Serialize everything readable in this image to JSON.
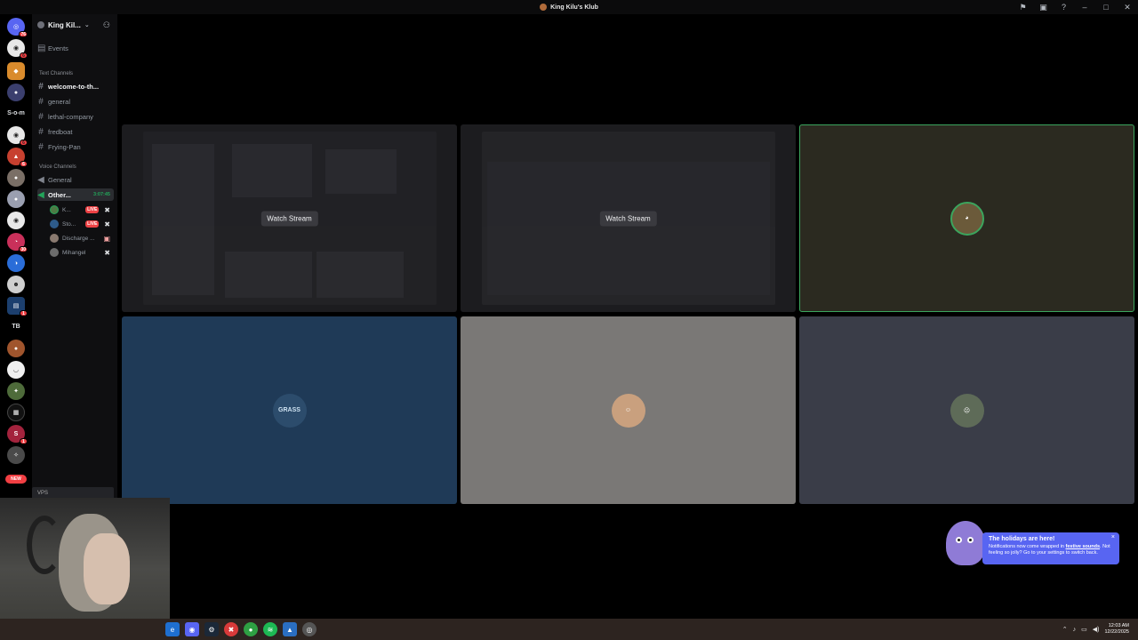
{
  "window": {
    "title": "King Kilu's Klub"
  },
  "titlebar_icons": [
    "flag-icon",
    "screen-icon",
    "help-icon"
  ],
  "server_rail": {
    "text_label": "S-o-m",
    "tb_label": "TB",
    "new_label": "NEW",
    "badges": [
      "76",
      "6",
      "6",
      "6",
      "30",
      "1",
      "1"
    ]
  },
  "sidebar": {
    "guild_name": "King Kil...",
    "events_label": "Events",
    "text_category": "Text Channels",
    "text_channels": [
      "welcome-to-th...",
      "general",
      "lethal-company",
      "fredboat",
      "Frying-Pan"
    ],
    "voice_category": "Voice Channels",
    "voice_channels": [
      "General",
      "Other..."
    ],
    "voice_timer": "3:07:45",
    "members": [
      {
        "name": "K...",
        "live": "LIVE"
      },
      {
        "name": "Sto...",
        "live": "LIVE"
      },
      {
        "name": "Discharge ...",
        "live": ""
      },
      {
        "name": "Mihangel",
        "live": ""
      }
    ],
    "user_panel_label": "VPS"
  },
  "tiles": {
    "watch_stream_label": "Watch Stream",
    "grass_label": "GRASS"
  },
  "toast": {
    "title": "The holidays are here!",
    "body_prefix": "Notifications now come wrapped in ",
    "link": "festive sounds",
    "body_suffix": ". Not feeling so jolly? Go to your settings to switch back.",
    "close": "×"
  },
  "taskbar": {
    "time": "12:03 AM",
    "date": "12/22/2025"
  },
  "colors": {
    "accent": "#5865f2",
    "live": "#ed4245",
    "speaking": "#3ba55d",
    "tile_blue": "#1f3a57",
    "tile_gray": "#7a7876",
    "tile_slate": "#3a3d48",
    "tile_olive": "#2b2a20"
  }
}
